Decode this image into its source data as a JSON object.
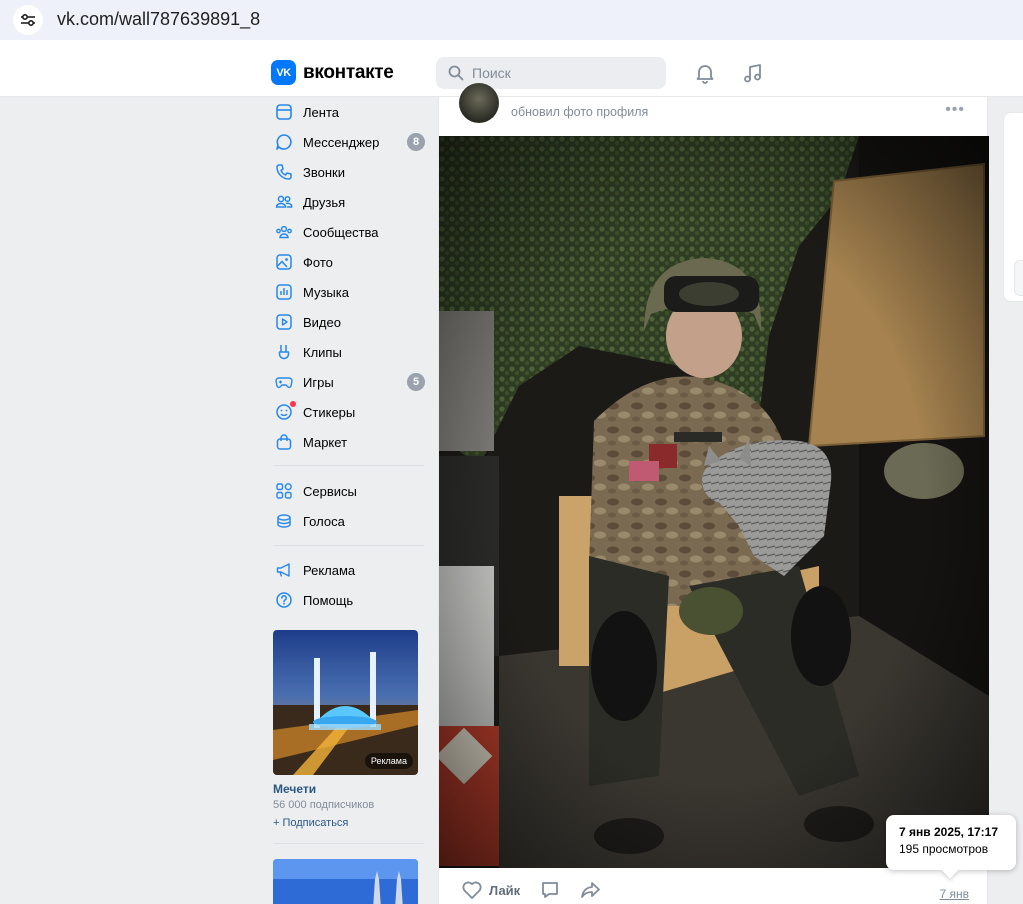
{
  "browser": {
    "url": "vk.com/wall787639891_8"
  },
  "header": {
    "logo_text": "вконтакте",
    "logo_mark": "VK",
    "search_placeholder": "Поиск"
  },
  "sidebar": {
    "items": [
      {
        "label": "Лента",
        "icon": "feed-icon"
      },
      {
        "label": "Мессенджер",
        "icon": "messenger-icon",
        "badge": "8"
      },
      {
        "label": "Звонки",
        "icon": "phone-icon"
      },
      {
        "label": "Друзья",
        "icon": "friends-icon"
      },
      {
        "label": "Сообщества",
        "icon": "communities-icon"
      },
      {
        "label": "Фото",
        "icon": "photo-icon"
      },
      {
        "label": "Музыка",
        "icon": "music-icon"
      },
      {
        "label": "Видео",
        "icon": "video-icon"
      },
      {
        "label": "Клипы",
        "icon": "clips-icon"
      },
      {
        "label": "Игры",
        "icon": "games-icon",
        "badge": "5"
      },
      {
        "label": "Стикеры",
        "icon": "stickers-icon"
      },
      {
        "label": "Маркет",
        "icon": "market-icon"
      },
      {
        "label": "Сервисы",
        "icon": "services-icon"
      },
      {
        "label": "Голоса",
        "icon": "votes-icon"
      },
      {
        "label": "Реклама",
        "icon": "ads-icon"
      },
      {
        "label": "Помощь",
        "icon": "help-icon"
      }
    ],
    "ad": {
      "badge": "Реклама",
      "title": "Мечети",
      "subscribers": "56 000 подписчиков",
      "subscribe": "+ Подписаться"
    }
  },
  "post": {
    "subtitle": "обновил фото профиля",
    "more": "•••",
    "like_label": "Лайк",
    "date": "7 янв"
  },
  "tooltip": {
    "datetime": "7 янв 2025, 17:17",
    "views": "195 просмотров"
  },
  "colors": {
    "accent": "#0077ff",
    "link": "#2a5885",
    "muted": "#818c99",
    "badge": "#99a2ad",
    "bg": "#edeef0"
  }
}
